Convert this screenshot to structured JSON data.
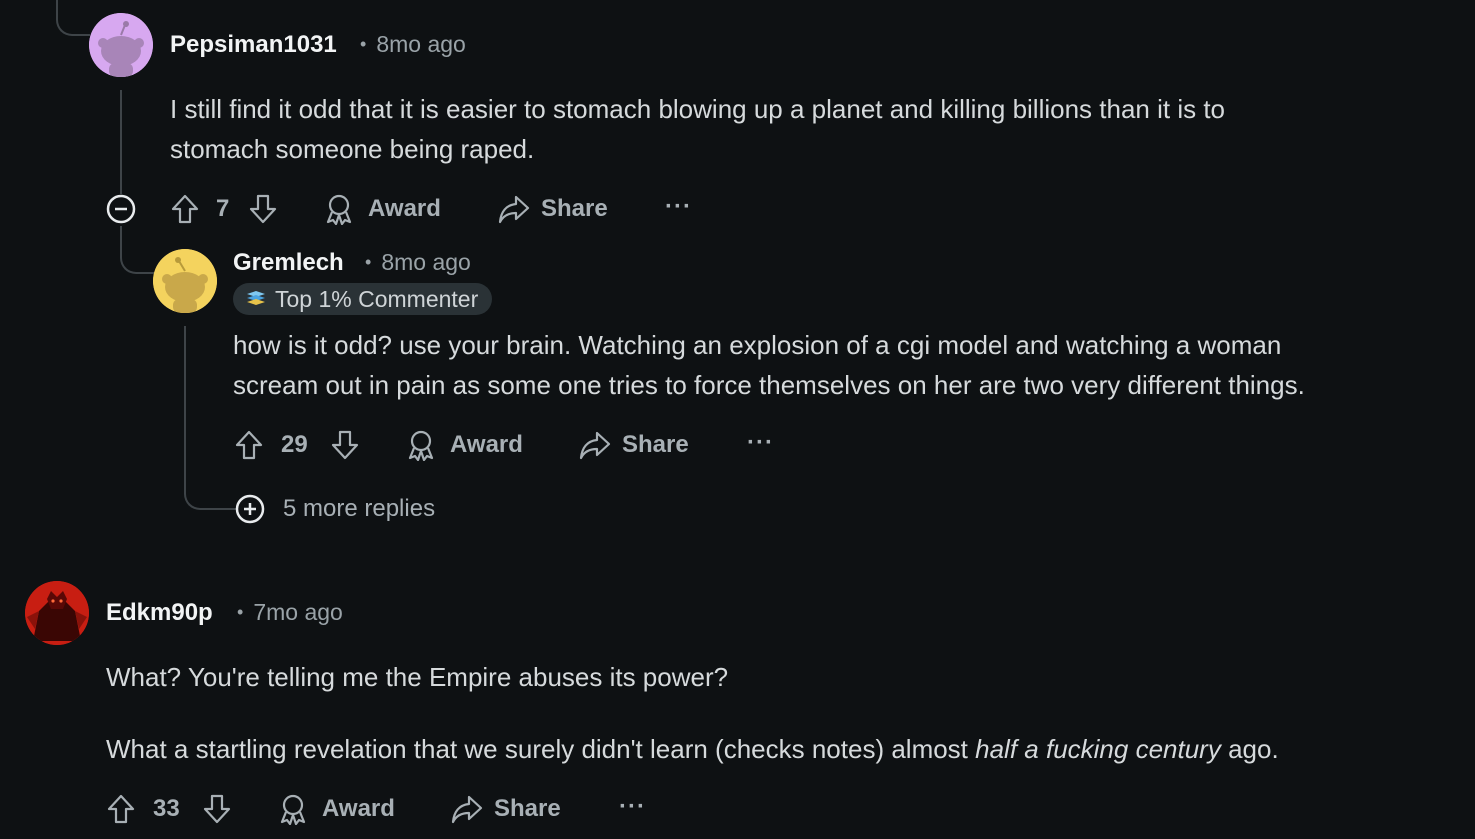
{
  "comments": [
    {
      "username": "Pepsiman1031",
      "time": "8mo ago",
      "body": [
        "I still find it odd that it is easier to stomach blowing up a planet and killing billions than it is to",
        "stomach someone being raped."
      ],
      "votes": "7",
      "award_label": "Award",
      "share_label": "Share",
      "more_label": "···"
    },
    {
      "username": "Gremlech",
      "time": "8mo ago",
      "flair": "Top 1% Commenter",
      "body": [
        "how is it odd? use your brain. Watching an explosion of a cgi model and watching a woman",
        "scream out in pain as some one tries to force themselves on her are two very different things."
      ],
      "votes": "29",
      "award_label": "Award",
      "share_label": "Share",
      "more_label": "···",
      "more_replies": "5 more replies"
    },
    {
      "username": "Edkm90p",
      "time": "7mo ago",
      "body_line1": "What? You're telling me the Empire abuses its power?",
      "body_line2_prefix": "What a startling revelation that we surely didn't learn (checks notes) almost ",
      "body_line2_italic": "half a fucking century",
      "body_line2_suffix": " ago.",
      "votes": "33",
      "award_label": "Award",
      "share_label": "Share",
      "more_label": "···"
    }
  ],
  "colors": {
    "background": "#0e1113",
    "thread_line": "#3e4448",
    "avatar_pepsiman": "#d7a8f0",
    "avatar_gremlech": "#f4d35e",
    "avatar_edkm": "#c81e12"
  }
}
